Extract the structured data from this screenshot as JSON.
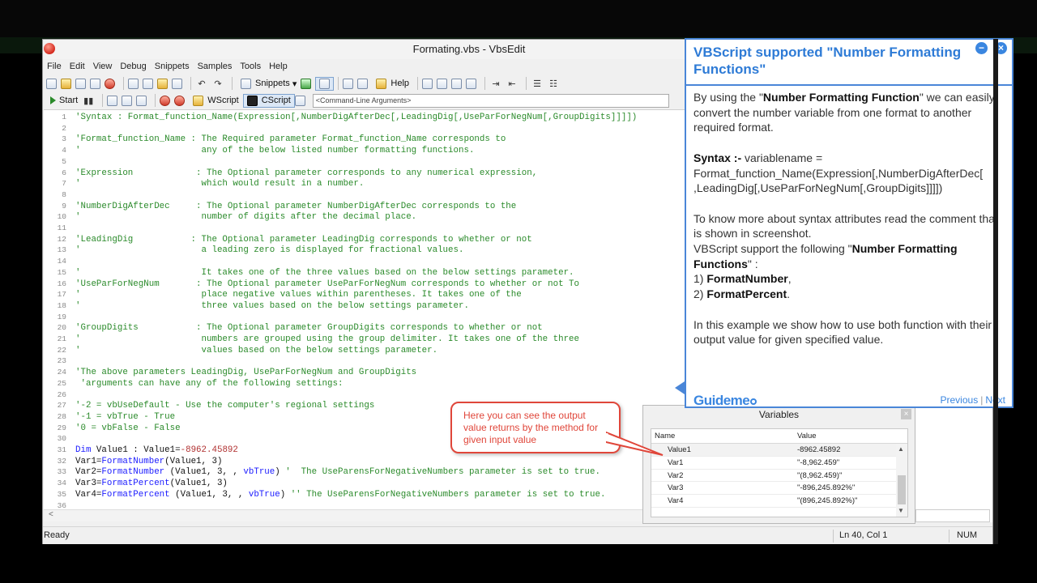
{
  "window": {
    "title": "Formating.vbs - VbsEdit"
  },
  "menu": [
    "File",
    "Edit",
    "View",
    "Debug",
    "Snippets",
    "Samples",
    "Tools",
    "Help"
  ],
  "toolbar": {
    "snippets_label": "Snippets",
    "help_label": "Help",
    "start_label": "Start",
    "wscript_label": "WScript",
    "cscript_label": "CScript",
    "cmd_placeholder": "<Command-Line Arguments>"
  },
  "code": [
    {
      "n": "1",
      "parts": [
        {
          "t": "'Syntax : Format_function_Name(Expression[,NumberDigAfterDec[,LeadingDig[,UseParForNegNum[,GroupDigits]]]])",
          "c": "cm"
        }
      ]
    },
    {
      "n": "2",
      "parts": []
    },
    {
      "n": "3",
      "parts": [
        {
          "t": "'Format_function_Name : The Required parameter Format_function_Name corresponds to",
          "c": "cm"
        }
      ]
    },
    {
      "n": "4",
      "parts": [
        {
          "t": "'                       any of the below listed number formatting functions.",
          "c": "cm"
        }
      ]
    },
    {
      "n": "5",
      "parts": []
    },
    {
      "n": "6",
      "parts": [
        {
          "t": "'Expression            : The Optional parameter corresponds to any numerical expression,",
          "c": "cm"
        }
      ]
    },
    {
      "n": "7",
      "parts": [
        {
          "t": "'                       which would result in a number.",
          "c": "cm"
        }
      ]
    },
    {
      "n": "8",
      "parts": []
    },
    {
      "n": "9",
      "parts": [
        {
          "t": "'NumberDigAfterDec     : The Optional parameter NumberDigAfterDec corresponds to the",
          "c": "cm"
        }
      ]
    },
    {
      "n": "10",
      "parts": [
        {
          "t": "'                       number of digits after the decimal place.",
          "c": "cm"
        }
      ]
    },
    {
      "n": "11",
      "parts": []
    },
    {
      "n": "12",
      "parts": [
        {
          "t": "'LeadingDig           : The Optional parameter LeadingDig corresponds to whether or not",
          "c": "cm"
        }
      ]
    },
    {
      "n": "13",
      "parts": [
        {
          "t": "'                       a leading zero is displayed for fractional values.",
          "c": "cm"
        }
      ]
    },
    {
      "n": "14",
      "parts": []
    },
    {
      "n": "15",
      "parts": [
        {
          "t": "'                       It takes one of the three values based on the below settings parameter.",
          "c": "cm"
        }
      ]
    },
    {
      "n": "16",
      "parts": [
        {
          "t": "'UseParForNegNum       : The Optional parameter UseParForNegNum corresponds to whether or not To",
          "c": "cm"
        }
      ]
    },
    {
      "n": "17",
      "parts": [
        {
          "t": "'                       place negative values within parentheses. It takes one of the",
          "c": "cm"
        }
      ]
    },
    {
      "n": "18",
      "parts": [
        {
          "t": "'                       three values based on the below settings parameter.",
          "c": "cm"
        }
      ]
    },
    {
      "n": "19",
      "parts": []
    },
    {
      "n": "20",
      "parts": [
        {
          "t": "'GroupDigits           : The Optional parameter GroupDigits corresponds to whether or not",
          "c": "cm"
        }
      ]
    },
    {
      "n": "21",
      "parts": [
        {
          "t": "'                       numbers are grouped using the group delimiter. It takes one of the three",
          "c": "cm"
        }
      ]
    },
    {
      "n": "22",
      "parts": [
        {
          "t": "'                       values based on the below settings parameter.",
          "c": "cm"
        }
      ]
    },
    {
      "n": "23",
      "parts": []
    },
    {
      "n": "24",
      "parts": [
        {
          "t": "'The above parameters LeadingDig, UseParForNegNum and GroupDigits",
          "c": "cm"
        }
      ]
    },
    {
      "n": "25",
      "parts": [
        {
          "t": " 'arguments can have any of the following settings:",
          "c": "cm"
        }
      ]
    },
    {
      "n": "26",
      "parts": []
    },
    {
      "n": "27",
      "parts": [
        {
          "t": "'-2 = vbUseDefault - Use the computer's regional settings",
          "c": "cm"
        }
      ]
    },
    {
      "n": "28",
      "parts": [
        {
          "t": "'-1 = vbTrue - True",
          "c": "cm"
        }
      ]
    },
    {
      "n": "29",
      "parts": [
        {
          "t": "'0 = vbFalse - False",
          "c": "cm"
        }
      ]
    },
    {
      "n": "30",
      "parts": []
    },
    {
      "n": "31",
      "parts": [
        {
          "t": "Dim",
          "c": "kw"
        },
        {
          "t": " Value1 : Value1=",
          "c": "tx"
        },
        {
          "t": "-8962.45892",
          "c": "nm"
        }
      ]
    },
    {
      "n": "32",
      "parts": [
        {
          "t": "Var1=",
          "c": "tx"
        },
        {
          "t": "FormatNumber",
          "c": "fn"
        },
        {
          "t": "(Value1, 3)",
          "c": "tx"
        }
      ]
    },
    {
      "n": "33",
      "parts": [
        {
          "t": "Var2=",
          "c": "tx"
        },
        {
          "t": "FormatNumber",
          "c": "fn"
        },
        {
          "t": " (Value1, 3, , ",
          "c": "tx"
        },
        {
          "t": "vbTrue",
          "c": "kw"
        },
        {
          "t": ") ",
          "c": "tx"
        },
        {
          "t": "'  The UseParensForNegativeNumbers parameter is set to true.",
          "c": "cm"
        }
      ]
    },
    {
      "n": "34",
      "parts": [
        {
          "t": "Var3=",
          "c": "tx"
        },
        {
          "t": "FormatPercent",
          "c": "fn"
        },
        {
          "t": "(Value1, 3)",
          "c": "tx"
        }
      ]
    },
    {
      "n": "35",
      "parts": [
        {
          "t": "Var4=",
          "c": "tx"
        },
        {
          "t": "FormatPercent",
          "c": "fn"
        },
        {
          "t": " (Value1, 3, , ",
          "c": "tx"
        },
        {
          "t": "vbTrue",
          "c": "kw"
        },
        {
          "t": ") ",
          "c": "tx"
        },
        {
          "t": "'' The UseParensForNegativeNumbers parameter is set to true.",
          "c": "cm"
        }
      ]
    },
    {
      "n": "36",
      "parts": []
    }
  ],
  "status": {
    "left": "Ready",
    "position": "Ln 40, Col 1",
    "num": "NUM"
  },
  "variables": {
    "title": "Variables",
    "col_name": "Name",
    "col_value": "Value",
    "rows": [
      {
        "name": "Value1",
        "value": "-8962.45892"
      },
      {
        "name": "Var1",
        "value": "\"-8,962.459\""
      },
      {
        "name": "Var2",
        "value": "\"(8,962.459)\""
      },
      {
        "name": "Var3",
        "value": "\"-896,245.892%\""
      },
      {
        "name": "Var4",
        "value": "\"(896,245.892%)\""
      }
    ]
  },
  "callout": {
    "text": "Here you can see the output value returns by the method for given input value"
  },
  "guide": {
    "title": "VBScript supported \"Number Formatting Functions\"",
    "p1_pre": "By using the \"",
    "p1_bold": "Number Formatting Function",
    "p1_post": "\" we can easily convert the number variable from one format to another required format.",
    "syntax_label": "Syntax :-",
    "syntax_text": " variablename = Format_function_Name(Expression[,NumberDigAfterDec[ ,LeadingDig[,UseParForNegNum[,GroupDigits]]]])",
    "p3": "To know more about syntax attributes read the comment that is shown in screenshot.",
    "p4_pre": "VBScript support the following \"",
    "p4_bold": "Number Formatting Functions",
    "p4_post": "\" :",
    "item1_num": "1) ",
    "item1": "FormatNumber",
    "item1_post": ",",
    "item2_num": "2) ",
    "item2": "FormatPercent",
    "item2_post": ".",
    "p5": "In this example we show how to use both function with their output value for given specified value.",
    "logo": "Guideme",
    "prev": "Previous",
    "divider": "|",
    "next": "Next"
  }
}
